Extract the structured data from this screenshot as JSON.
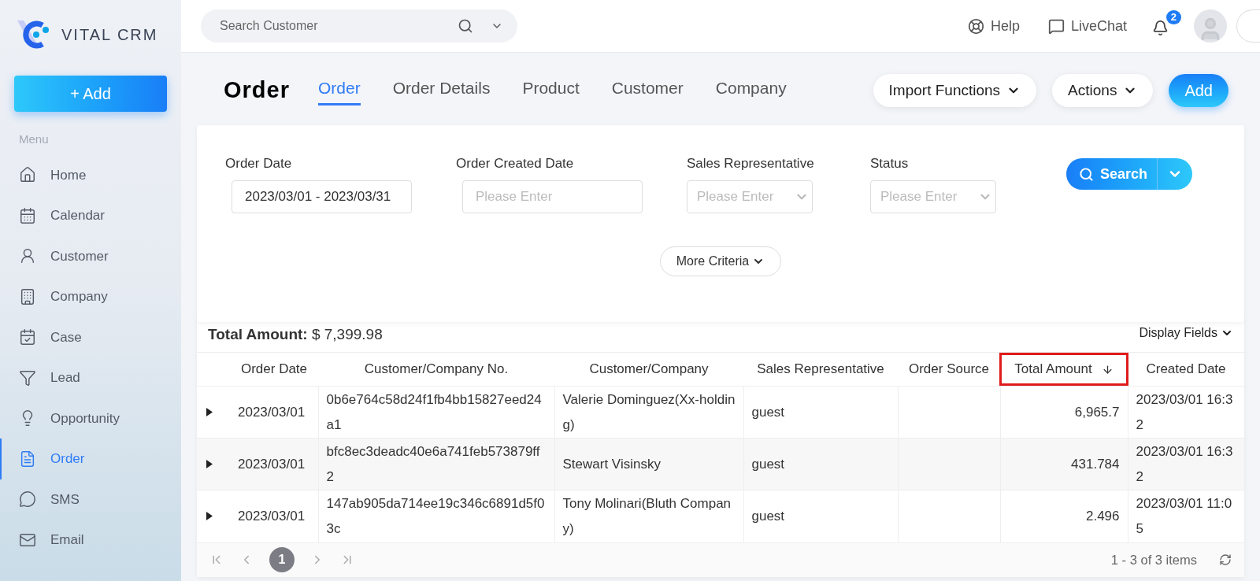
{
  "logo": {
    "text": "VITAL CRM"
  },
  "sidebar": {
    "add_button": "+ Add",
    "menu_label": "Menu",
    "items": [
      {
        "label": "Home",
        "selected": false
      },
      {
        "label": "Calendar",
        "selected": false
      },
      {
        "label": "Customer",
        "selected": false
      },
      {
        "label": "Company",
        "selected": false
      },
      {
        "label": "Case",
        "selected": false
      },
      {
        "label": "Lead",
        "selected": false
      },
      {
        "label": "Opportunity",
        "selected": false
      },
      {
        "label": "Order",
        "selected": true
      },
      {
        "label": "SMS",
        "selected": false
      },
      {
        "label": "Email",
        "selected": false
      }
    ]
  },
  "topbar": {
    "search": {
      "placeholder": "Search Customer"
    },
    "help": "Help",
    "livechat": "LiveChat",
    "notifications": "2"
  },
  "page": {
    "title": "Order",
    "tabs": [
      {
        "label": "Order",
        "selected": true
      },
      {
        "label": "Order Details",
        "selected": false
      },
      {
        "label": "Product",
        "selected": false
      },
      {
        "label": "Customer",
        "selected": false
      },
      {
        "label": "Company",
        "selected": false
      }
    ],
    "buttons": {
      "import": "Import Functions",
      "actions": "Actions",
      "add": "Add"
    }
  },
  "filters": {
    "fields": [
      {
        "label": "Order Date",
        "kind": "text",
        "value": "2023/03/01 - 2023/03/31"
      },
      {
        "label": "Order Created Date",
        "kind": "text",
        "placeholder": "Please Enter"
      },
      {
        "label": "Sales Representative",
        "kind": "select",
        "placeholder": "Please Enter"
      },
      {
        "label": "Status",
        "kind": "select",
        "placeholder": "Please Enter"
      }
    ],
    "search_button": "Search",
    "more_criteria": "More Criteria"
  },
  "table": {
    "total_label": "Total Amount:",
    "total_value": "$ 7,399.98",
    "display_fields": "Display Fields",
    "columns": [
      {
        "label": "Order Date",
        "highlighted": false,
        "sort_desc": false
      },
      {
        "label": "Customer/Company No.",
        "highlighted": false,
        "sort_desc": false
      },
      {
        "label": "Customer/Company",
        "highlighted": false,
        "sort_desc": false
      },
      {
        "label": "Sales Representative",
        "highlighted": false,
        "sort_desc": false
      },
      {
        "label": "Order Source",
        "highlighted": false,
        "sort_desc": false
      },
      {
        "label": "Total Amount",
        "highlighted": true,
        "sort_desc": true
      },
      {
        "label": "Created Date",
        "highlighted": false,
        "sort_desc": false
      }
    ],
    "rows": [
      {
        "cells": [
          "2023/03/01",
          "0b6e764c58d24f1fb4bb15827eed24a1",
          "Valerie Dominguez(Xx-holding)",
          "guest",
          "",
          "6,965.7",
          "2023/03/01 16:32"
        ]
      },
      {
        "cells": [
          "2023/03/01",
          "bfc8ec3deadc40e6a741feb573879ff2",
          "Stewart Visinsky",
          "guest",
          "",
          "431.784",
          "2023/03/01 16:32"
        ]
      },
      {
        "cells": [
          "2023/03/01",
          "147ab905da714ee19c346c6891d5f03c",
          "Tony Molinari(Bluth Company)",
          "guest",
          "",
          "2.496",
          "2023/03/01 11:05"
        ]
      }
    ],
    "pagination": {
      "current_page": "1",
      "summary": "1 - 3 of 3 items"
    }
  }
}
